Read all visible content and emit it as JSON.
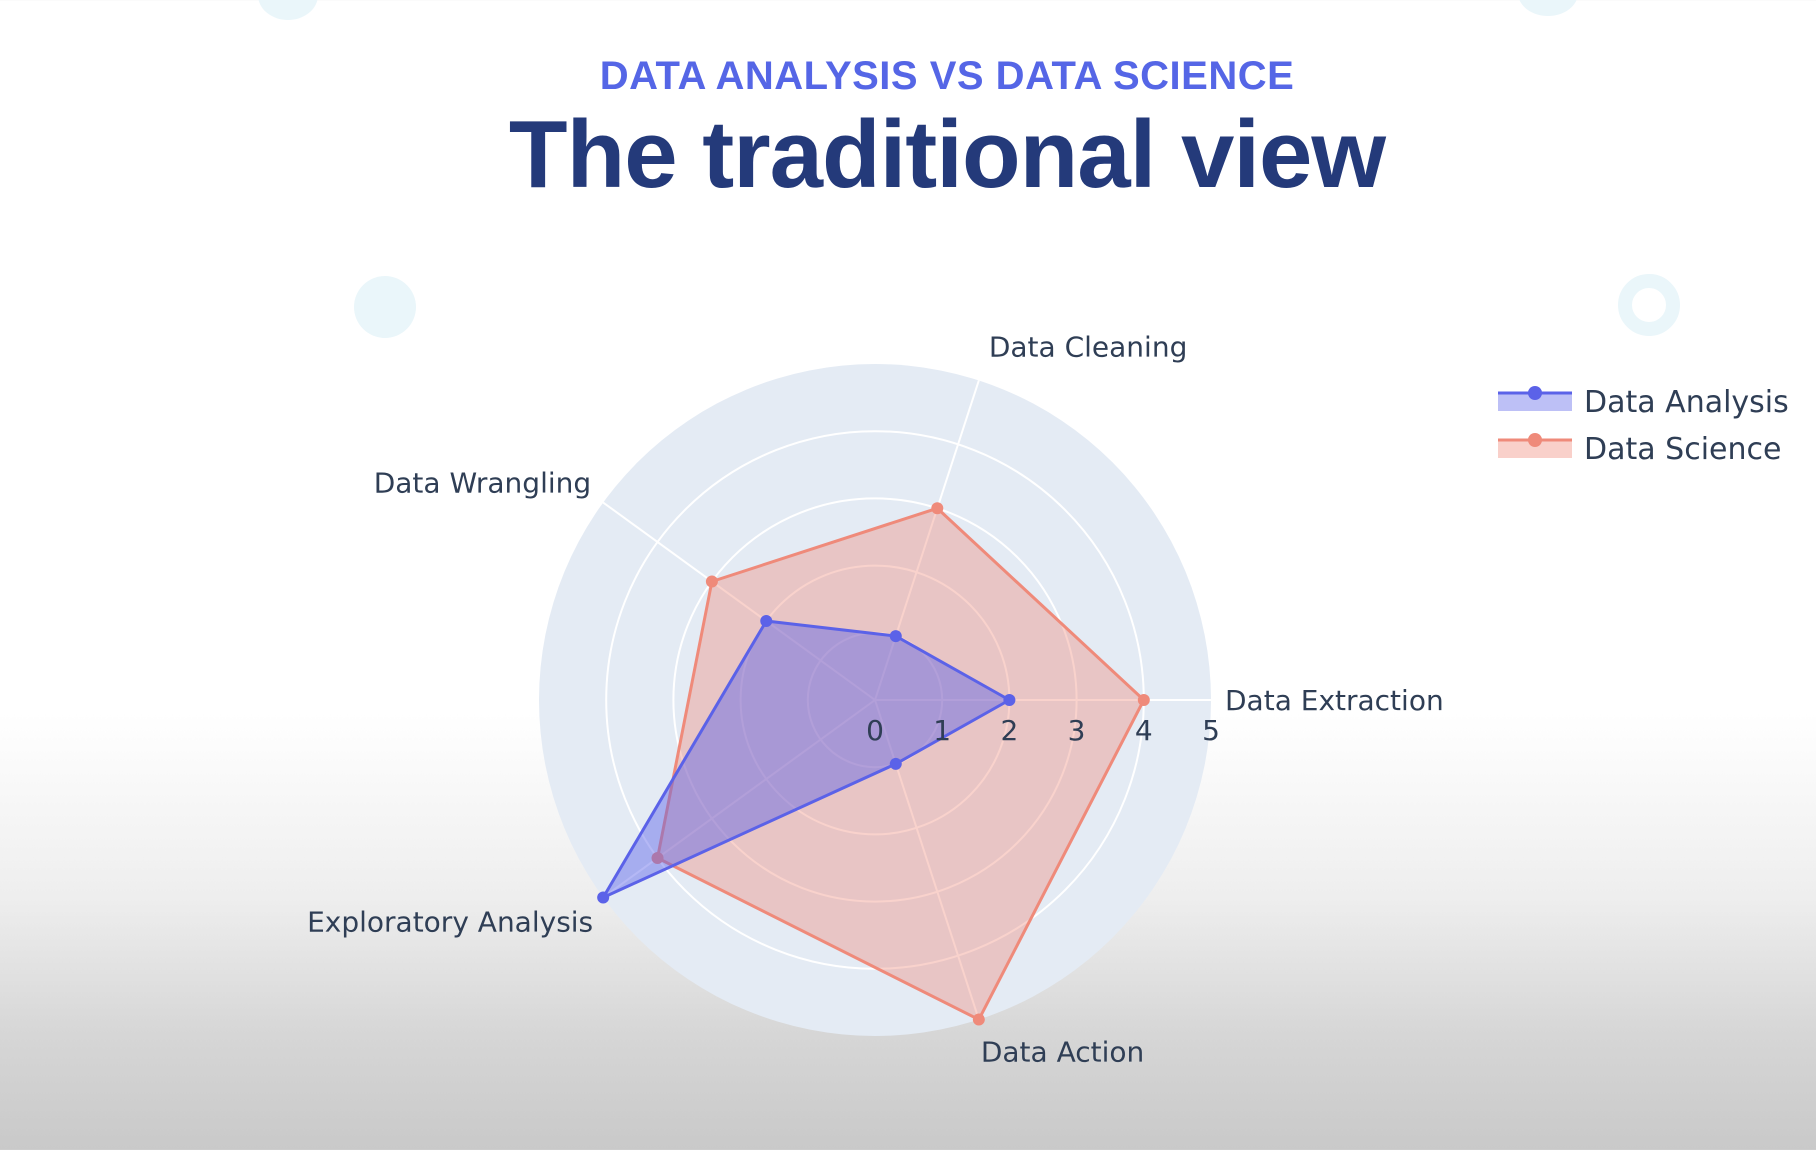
{
  "header": {
    "kicker": "DATA ANALYSIS VS DATA SCIENCE",
    "title": "The traditional view"
  },
  "colors": {
    "analysis": "#5b62e8",
    "science": "#ef8a7a",
    "polar_bg": "#e4ebf4",
    "grid": "#ffffff",
    "kicker": "#5566e6",
    "title": "#243a7a"
  },
  "chart_data": {
    "type": "radar",
    "title": "",
    "categories": [
      "Data Extraction",
      "Data Cleaning",
      "Data Wrangling",
      "Exploratory Analysis",
      "Data Action"
    ],
    "radial_ticks": [
      "0",
      "1",
      "2",
      "3",
      "4",
      "5"
    ],
    "rlim": [
      0,
      5
    ],
    "grid": true,
    "legend_position": "top-right",
    "series": [
      {
        "name": "Data Analysis",
        "values": [
          2,
          1,
          2,
          5,
          1
        ]
      },
      {
        "name": "Data Science",
        "values": [
          4,
          3,
          3,
          4,
          5
        ]
      }
    ]
  }
}
